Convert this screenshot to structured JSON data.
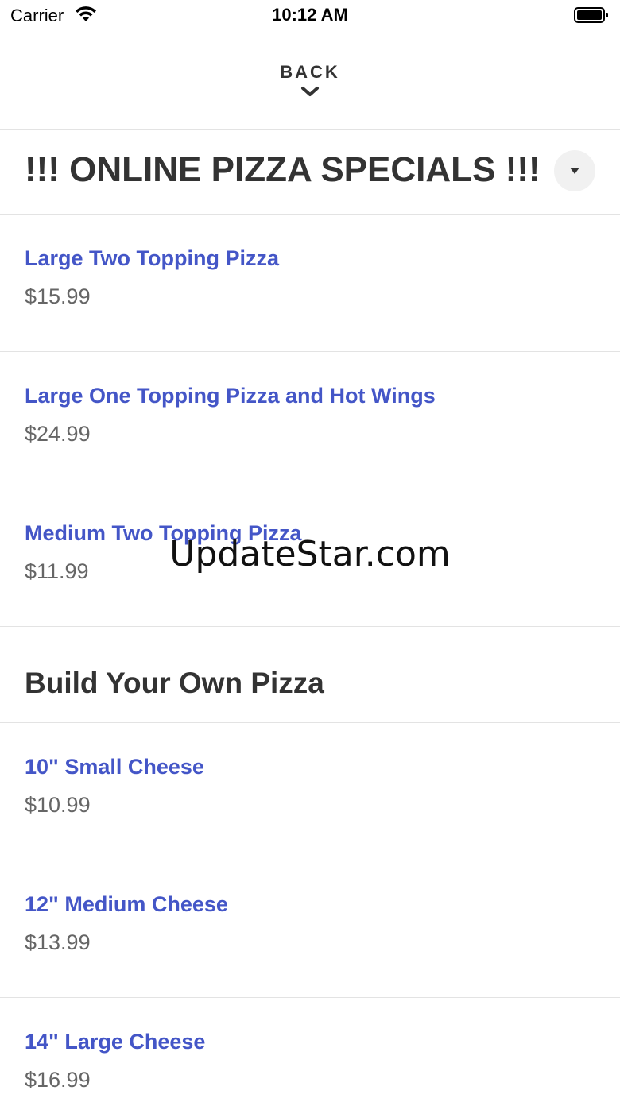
{
  "status_bar": {
    "carrier": "Carrier",
    "time": "10:12 AM",
    "wifi_icon": "wifi-icon",
    "battery_icon": "battery-full-icon"
  },
  "nav": {
    "back_label": "BACK",
    "back_icon": "chevron-down-icon"
  },
  "specials": {
    "title": "!!! ONLINE PIZZA SPECIALS !!!",
    "collapse_icon": "caret-down-icon",
    "items": [
      {
        "name": "Large Two Topping Pizza",
        "price": "$15.99"
      },
      {
        "name": "Large One Topping Pizza and Hot Wings",
        "price": "$24.99"
      },
      {
        "name": "Medium Two Topping Pizza",
        "price": "$11.99"
      }
    ]
  },
  "build_your_own": {
    "title": "Build Your Own Pizza",
    "items": [
      {
        "name": "10\" Small Cheese",
        "price": "$10.99"
      },
      {
        "name": "12\" Medium Cheese",
        "price": "$13.99"
      },
      {
        "name": "14\" Large Cheese",
        "price": "$16.99"
      }
    ]
  },
  "watermark": "UpdateStar.com",
  "colors": {
    "link": "#4456c7",
    "price": "#666666",
    "heading": "#333333",
    "divider": "#e3e3e3"
  }
}
